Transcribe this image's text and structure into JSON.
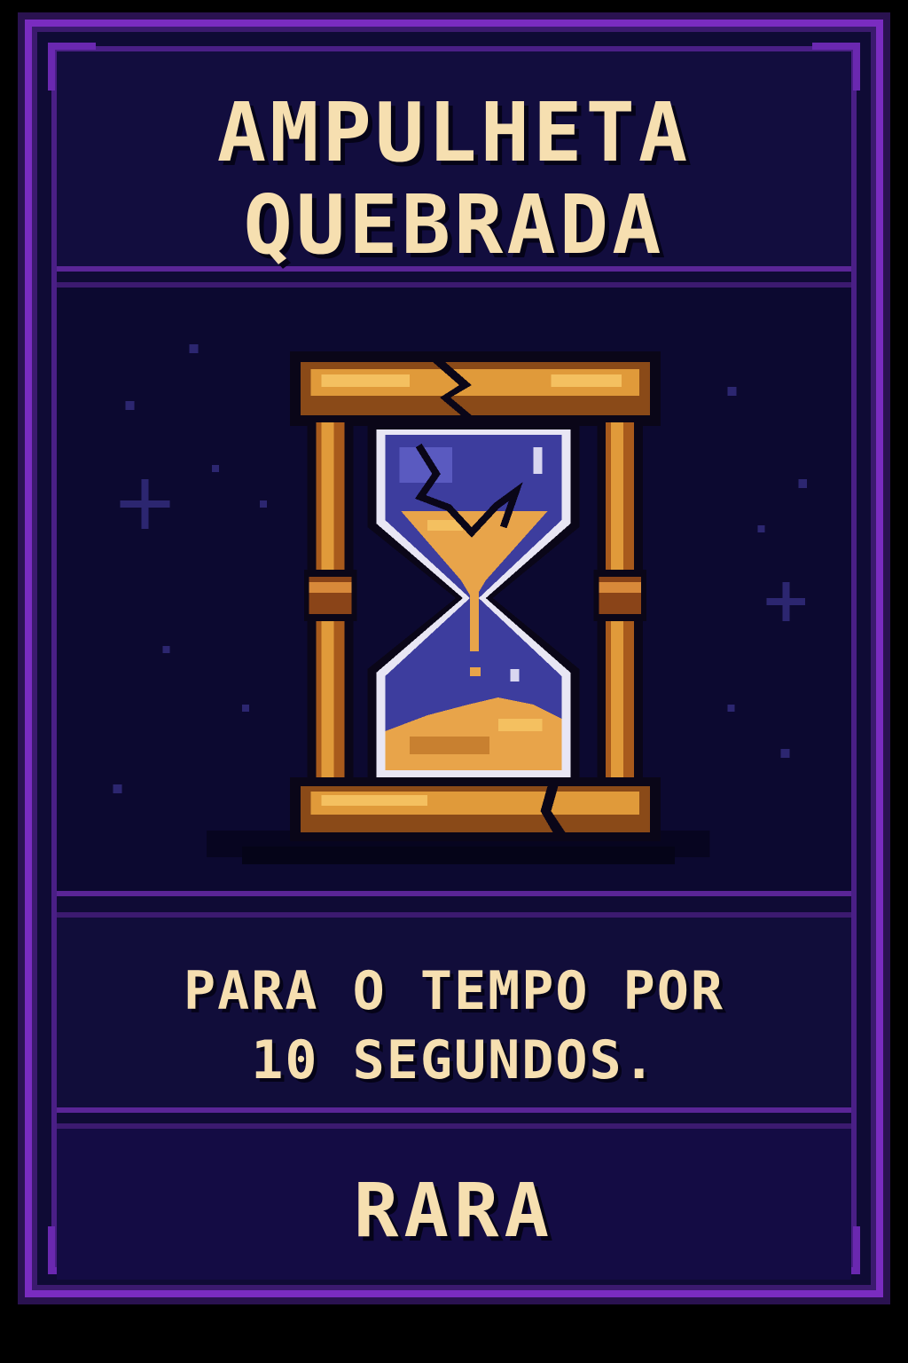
{
  "card": {
    "title_lines": [
      "AMPULHETA",
      "QUEBRADA"
    ],
    "description_lines": [
      "PARA O TEMPO POR",
      "10 SEGUNDOS."
    ],
    "rarity": "RARA"
  },
  "icons": {
    "artwork": "broken-hourglass-icon",
    "corners": "ornament-corner-icon",
    "stars": "sparkle-star-icon"
  },
  "colors": {
    "frame_purple": "#7a2cc0",
    "frame_dark": "#2a1250",
    "background_navy": "#0f0b35",
    "text_cream": "#f6dfb0",
    "wood_orange": "#e09a3a",
    "glass_blue": "#3d3d9e",
    "sand_orange": "#e8a44a"
  }
}
